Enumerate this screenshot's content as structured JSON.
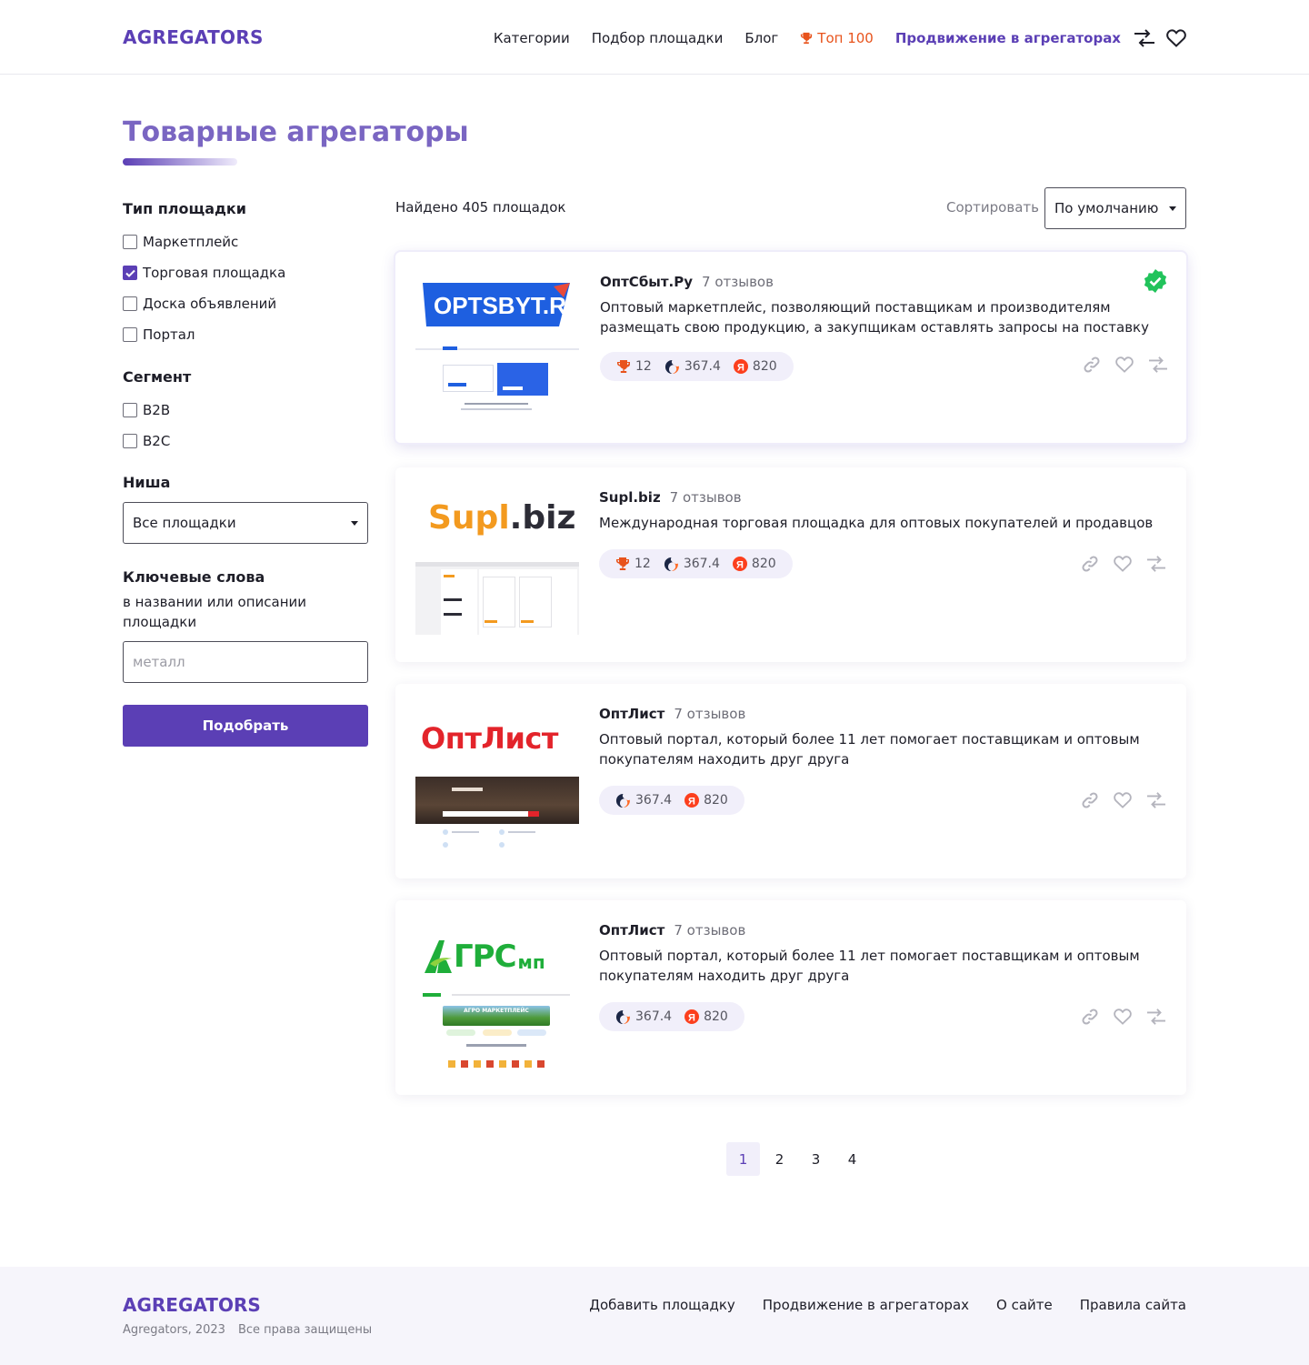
{
  "header": {
    "logo": "AGREGATORS",
    "nav": [
      "Категории",
      "Подбор площадки",
      "Блог"
    ],
    "top100": "Топ 100",
    "promo": "Продвижение в агрегаторах"
  },
  "page": {
    "title": "Товарные агрегаторы"
  },
  "filters": {
    "type_title": "Тип площадки",
    "types": [
      {
        "label": "Маркетплейс",
        "checked": false
      },
      {
        "label": "Торговая площадка",
        "checked": true
      },
      {
        "label": "Доска объявлений",
        "checked": false
      },
      {
        "label": "Портал",
        "checked": false
      }
    ],
    "segment_title": "Сегмент",
    "segments": [
      {
        "label": "B2B",
        "checked": false
      },
      {
        "label": "B2C",
        "checked": false
      }
    ],
    "niche_title": "Ниша",
    "niche_value": "Все площадки",
    "keywords_title": "Ключевые слова",
    "keywords_hint": "в названии или описании площадки",
    "keywords_placeholder": "металл",
    "submit": "Подобрать"
  },
  "results": {
    "found": "Найдено 405 площадок",
    "sort_label": "Сортировать",
    "sort_value": "По умолчанию"
  },
  "cards": [
    {
      "name": "ОптСбыт.Ру",
      "reviews": "7 отзывов",
      "description": "Оптовый маркетплейс, позволяющий поставщикам и производителям размещать свою продукцию, а закупщикам оставлять запросы на поставку",
      "logo_text": "OPTSBYT.RU",
      "top": "12",
      "similarweb": "367.4",
      "yandex": "820",
      "verified": true
    },
    {
      "name": "Supl.biz",
      "reviews": "7 отзывов",
      "description": "Международная торговая площадка для оптовых покупателей и продавцов",
      "logo_a": "Supl",
      "logo_b": ".biz",
      "top": "12",
      "similarweb": "367.4",
      "yandex": "820",
      "verified": false
    },
    {
      "name": "ОптЛист",
      "reviews": "7 отзывов",
      "description": "Оптовый портал, который более 11 лет помогает поставщикам и оптовым покупателям находить друг друга",
      "logo_text": "ОптЛист",
      "similarweb": "367.4",
      "yandex": "820",
      "verified": false
    },
    {
      "name": "ОптЛист",
      "reviews": "7 отзывов",
      "description": "Оптовый портал, который более 11 лет помогает поставщикам и оптовым покупателям находить друг друга",
      "logo_a": "ГРС",
      "logo_b": "мп",
      "shot_banner": "АГРО МАРКЕТПЛЕЙС",
      "similarweb": "367.4",
      "yandex": "820",
      "verified": false
    }
  ],
  "pagination": [
    "1",
    "2",
    "3",
    "4"
  ],
  "footer": {
    "logo": "AGREGATORS",
    "copyright": "Agregators, 2023",
    "rights": "Все права защищены",
    "links": [
      "Добавить площадку",
      "Продвижение в агрегаторах",
      "О сайте",
      "Правила сайта"
    ]
  },
  "colors": {
    "accent": "#5b3fb5",
    "title": "#7a66c2",
    "top100": "#e8531c",
    "verified": "#21c35b",
    "metrics_bg": "#f1effa"
  },
  "icons": [
    "trophy-icon",
    "compare-icon",
    "heart-icon",
    "link-icon",
    "similarweb-icon",
    "yandex-icon",
    "verified-icon",
    "caret-down-icon",
    "check-icon"
  ]
}
